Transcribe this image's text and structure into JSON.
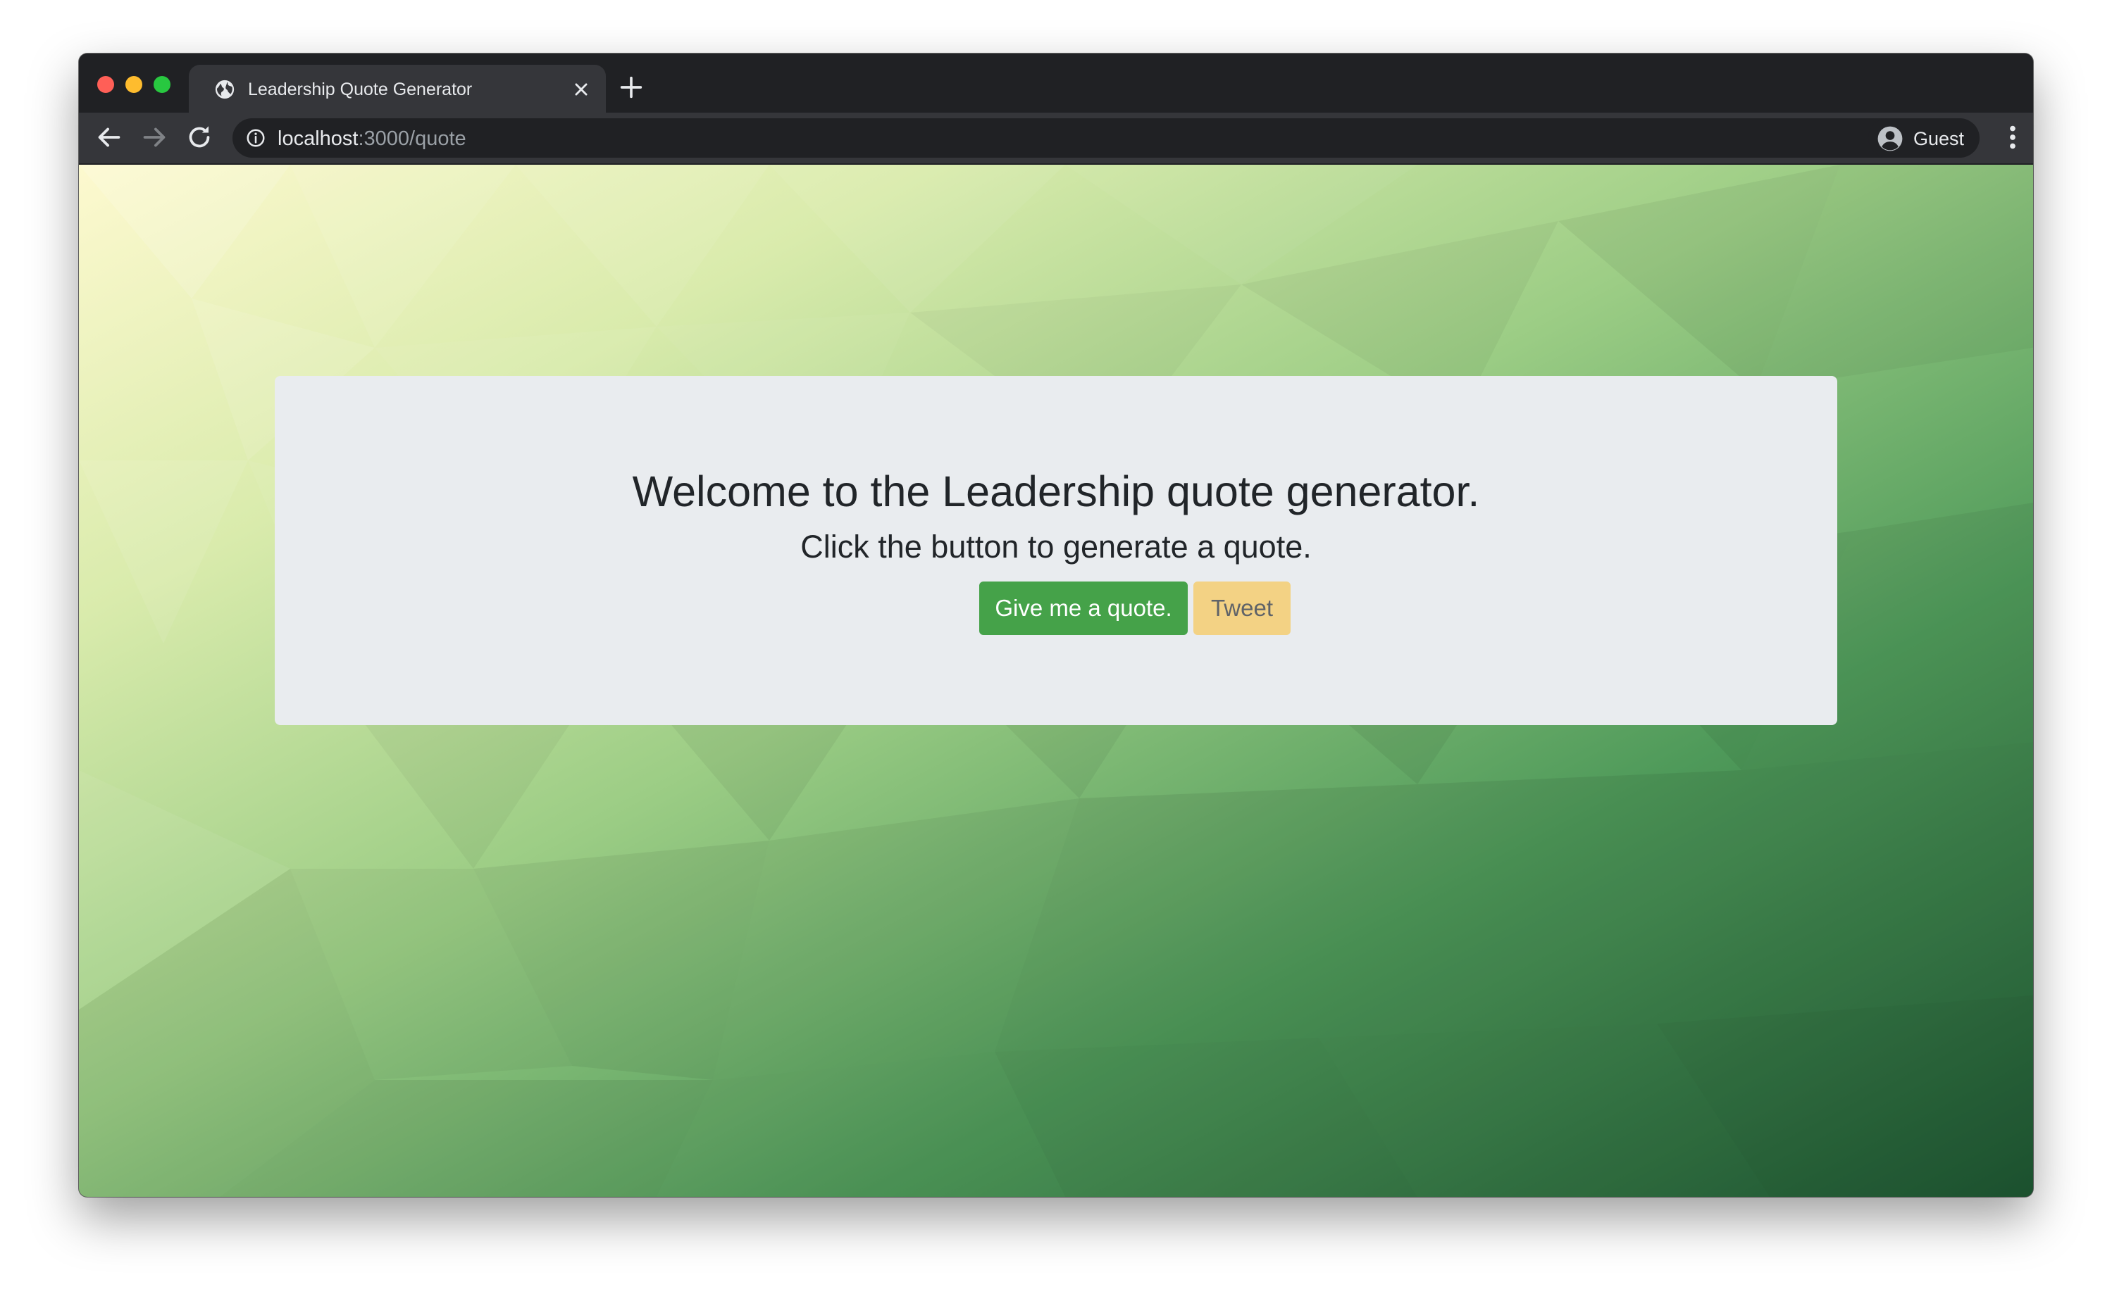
{
  "browser": {
    "tab": {
      "title": "Leadership Quote Generator",
      "favicon": "globe-icon"
    },
    "address_bar": {
      "host": "localhost",
      "rest": ":3000/quote"
    },
    "profile": {
      "label": "Guest"
    },
    "icons": {
      "back": "arrow-left-icon",
      "forward": "arrow-right-icon",
      "reload": "reload-icon",
      "info": "info-icon",
      "new_tab": "plus-icon",
      "close_tab": "close-icon",
      "menu": "kebab-menu-icon"
    }
  },
  "page": {
    "headline": "Welcome to the Leadership quote generator.",
    "subline": "Click the button to generate a quote.",
    "quote_button": "Give me a quote.",
    "tweet_button": "Tweet"
  },
  "colors": {
    "quote_button": "#45a249",
    "tweet_button": "#f3d284",
    "panel": "#e9ecef",
    "background_light": "#fdf9cf",
    "background_dark": "#1f5a34"
  }
}
